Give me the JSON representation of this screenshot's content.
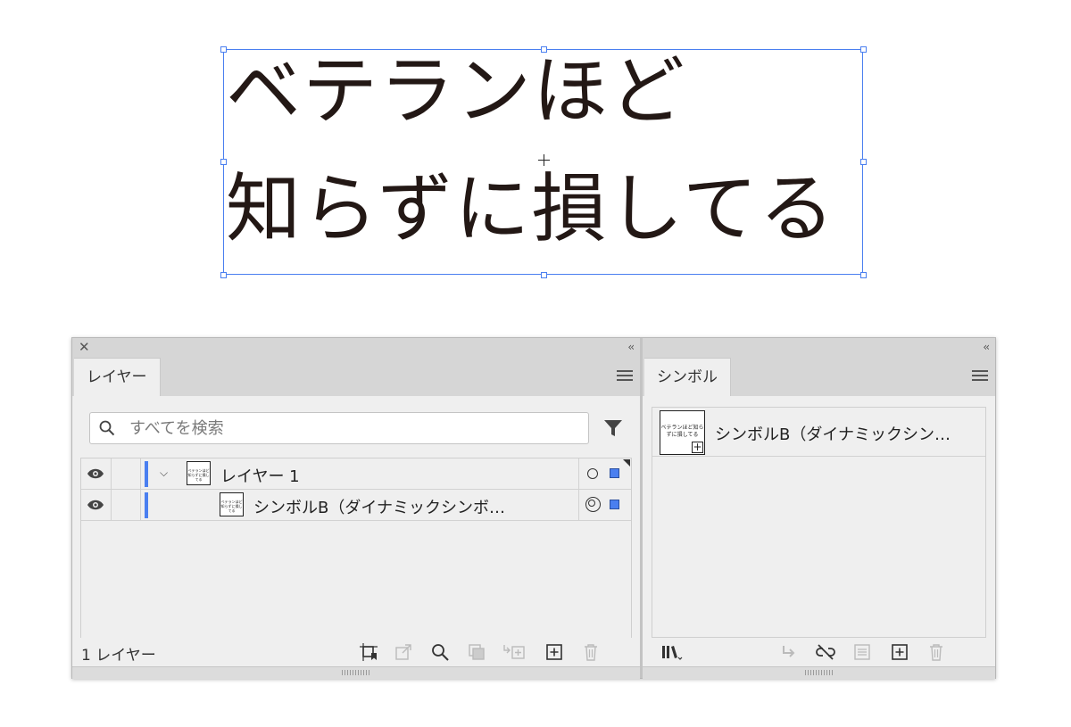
{
  "artwork": {
    "line1": "ベテランほど",
    "line2": "知らずに損してる",
    "selection_color": "#4a7ff0"
  },
  "layers_panel": {
    "tab_label": "レイヤー",
    "search": {
      "placeholder": "すべてを検索",
      "value": ""
    },
    "rows": [
      {
        "name": "レイヤー 1",
        "thumb_text": "ベテランほど知らずに損してる",
        "expanded": true
      },
      {
        "name": "シンボルB（ダイナミックシンボ…",
        "thumb_text": "ベテランほど知らずに損してる"
      }
    ],
    "footer_count": "1 レイヤー",
    "layer_color": "#4a7ff0"
  },
  "symbols_panel": {
    "tab_label": "シンボル",
    "items": [
      {
        "name": "シンボルB（ダイナミックシン…",
        "thumb_text": "ベテランほど知らずに損してる"
      }
    ]
  },
  "icons": {
    "close": "✕",
    "collapse": "‹‹",
    "chevron": "⌵"
  }
}
